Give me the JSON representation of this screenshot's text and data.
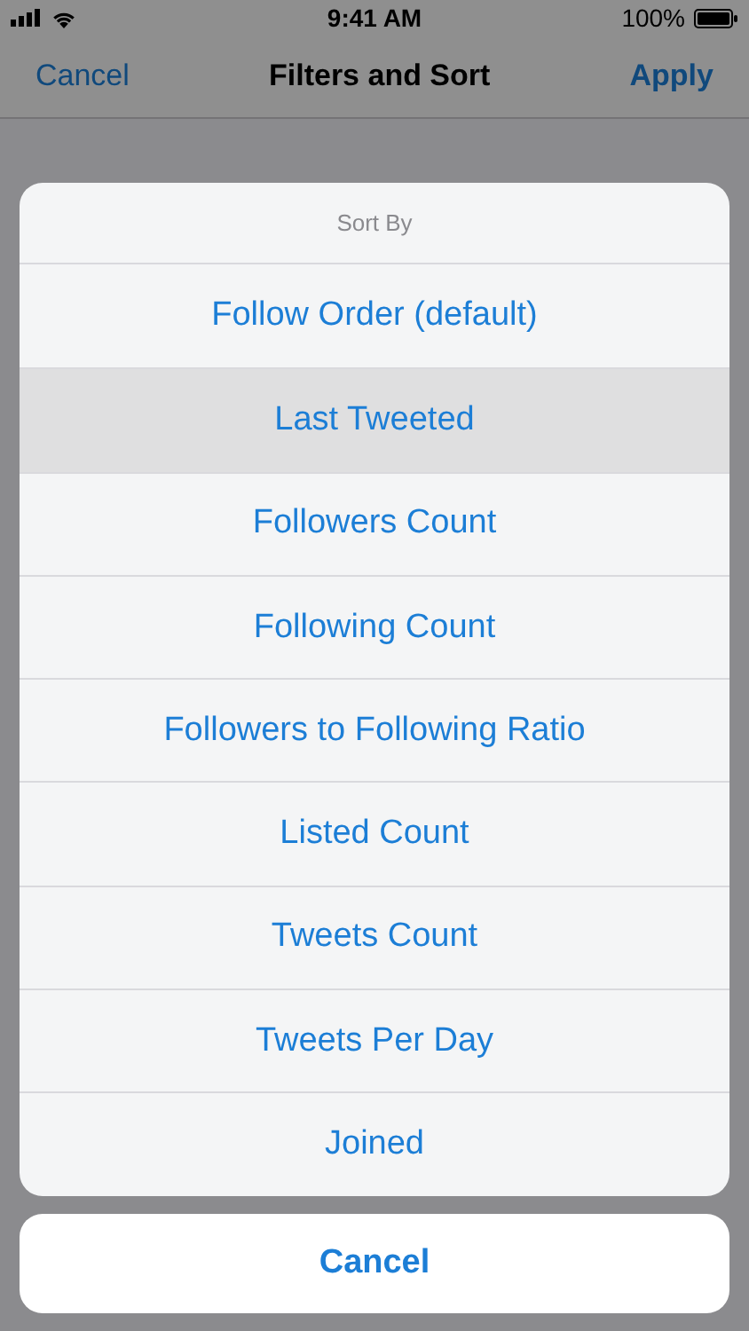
{
  "status_bar": {
    "time": "9:41 AM",
    "battery": "100%"
  },
  "nav_bar": {
    "left": "Cancel",
    "title": "Filters and Sort",
    "right": "Apply"
  },
  "action_sheet": {
    "title": "Sort By",
    "options": [
      {
        "label": "Follow Order (default)",
        "selected": false
      },
      {
        "label": "Last Tweeted",
        "selected": true
      },
      {
        "label": "Followers Count",
        "selected": false
      },
      {
        "label": "Following Count",
        "selected": false
      },
      {
        "label": "Followers to Following Ratio",
        "selected": false
      },
      {
        "label": "Listed Count",
        "selected": false
      },
      {
        "label": "Tweets Count",
        "selected": false
      },
      {
        "label": "Tweets Per Day",
        "selected": false
      },
      {
        "label": "Joined",
        "selected": false
      }
    ],
    "cancel": "Cancel"
  }
}
